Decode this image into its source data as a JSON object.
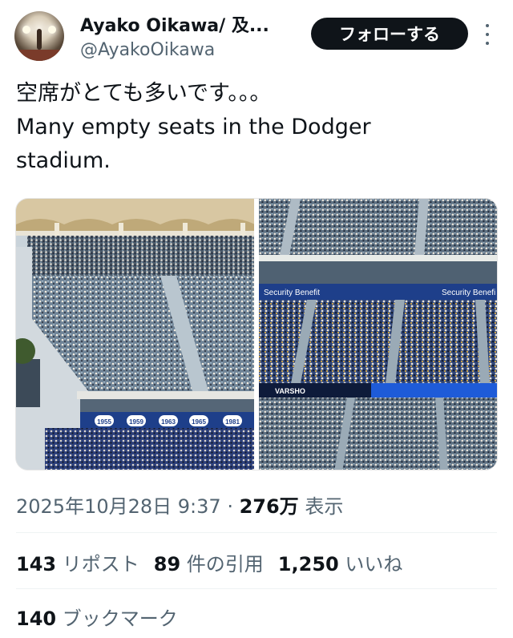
{
  "author": {
    "display_name": "Ayako Oikawa/ 及...",
    "handle": "@AyakoOikawa"
  },
  "follow_button": {
    "label": "フォローする"
  },
  "more_icon": "more-vertical-icon",
  "tweet": {
    "text": "空席がとても多いです。。。\nMany empty seats in the Dodger\nstadium."
  },
  "media": {
    "left_photo": {
      "banners": [
        "1955",
        "1959",
        "1963",
        "1965",
        "1981"
      ]
    },
    "right_photo": {
      "sponsor_left": "Security Benefit",
      "sponsor_right": "Security Benefi",
      "scoreboard": "VARSHO"
    }
  },
  "meta": {
    "timestamp": "2025年10月28日 9:37",
    "separator": " · ",
    "views_count": "276万",
    "views_label": "表示"
  },
  "stats": {
    "reposts_count": "143",
    "reposts_label": "リポスト",
    "quotes_count": "89",
    "quotes_label": "件の引用",
    "likes_count": "1,250",
    "likes_label": "いいね",
    "bookmarks_count": "140",
    "bookmarks_label": "ブックマーク"
  },
  "colors": {
    "text_primary": "#0f1419",
    "text_secondary": "#536471",
    "button_bg": "#0f1419",
    "divider": "#eff3f4",
    "dodger_blue": "#1e3f8a"
  }
}
